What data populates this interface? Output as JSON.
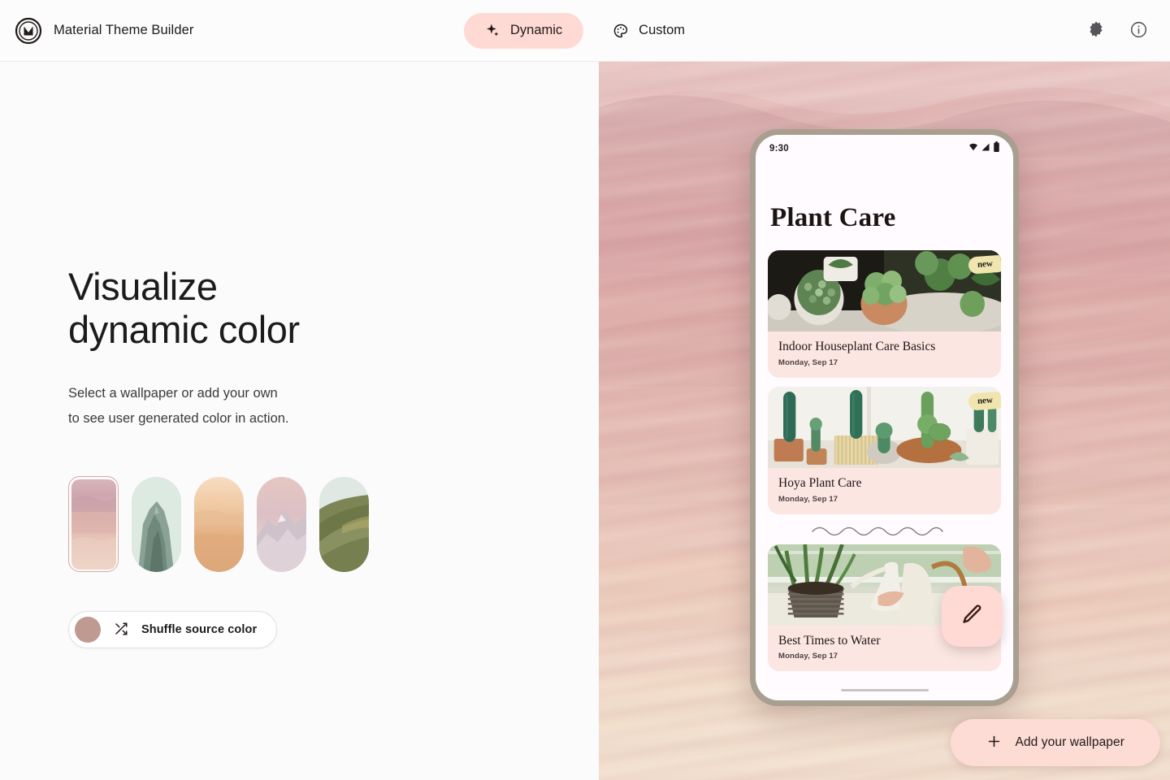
{
  "header": {
    "logo_icon": "material-m-logo-icon",
    "title": "Material Theme Builder",
    "tabs": [
      {
        "label": "Dynamic",
        "icon": "sparkle-icon",
        "active": true
      },
      {
        "label": "Custom",
        "icon": "palette-icon",
        "active": false
      }
    ],
    "actions": [
      {
        "name": "dark-mode-toggle",
        "icon": "brightness-contrast-icon"
      },
      {
        "name": "info-button",
        "icon": "info-circle-icon"
      }
    ]
  },
  "left_panel": {
    "headline_line1": "Visualize",
    "headline_line2": "dynamic color",
    "subcopy_line1": "Select a wallpaper or add your own",
    "subcopy_line2": "to see user generated color in action.",
    "wallpapers": [
      {
        "name": "pink-dunes",
        "selected": true
      },
      {
        "name": "green-rock",
        "selected": false
      },
      {
        "name": "peach-desert",
        "selected": false
      },
      {
        "name": "lilac-mountain",
        "selected": false
      },
      {
        "name": "olive-hillside",
        "selected": false
      }
    ],
    "shuffle": {
      "label": "Shuffle source color",
      "icon": "shuffle-icon",
      "swatch_color": "#bf9a91"
    }
  },
  "preview": {
    "wallpaper_name": "pink-dunes",
    "status_bar": {
      "time": "9:30",
      "icons": [
        "wifi-icon",
        "signal-icon",
        "battery-icon"
      ]
    },
    "app_title": "Plant Care",
    "cards": [
      {
        "title": "Indoor Houseplant Care Basics",
        "date": "Monday, Sep 17",
        "badge": "new",
        "image": "potted-succulents-photo"
      },
      {
        "title": "Hoya Plant Care",
        "date": "Monday, Sep 17",
        "badge": "new",
        "image": "cactus-shelf-photo"
      },
      {
        "title": "Best Times to Water",
        "date": "Monday, Sep 17",
        "badge": null,
        "image": "watering-can-photo"
      }
    ],
    "fab": {
      "name": "edit-fab",
      "icon": "pencil-icon"
    },
    "divider": "wavy-divider"
  },
  "add_wallpaper": {
    "label": "Add your wallpaper",
    "icon": "plus-icon"
  },
  "colors": {
    "accent_container": "#ffdad4",
    "surface": "#fbfbfb",
    "badge_yellow": "#f0e5ae",
    "card_surface": "#fbe6e2",
    "source_swatch": "#bf9a91"
  }
}
